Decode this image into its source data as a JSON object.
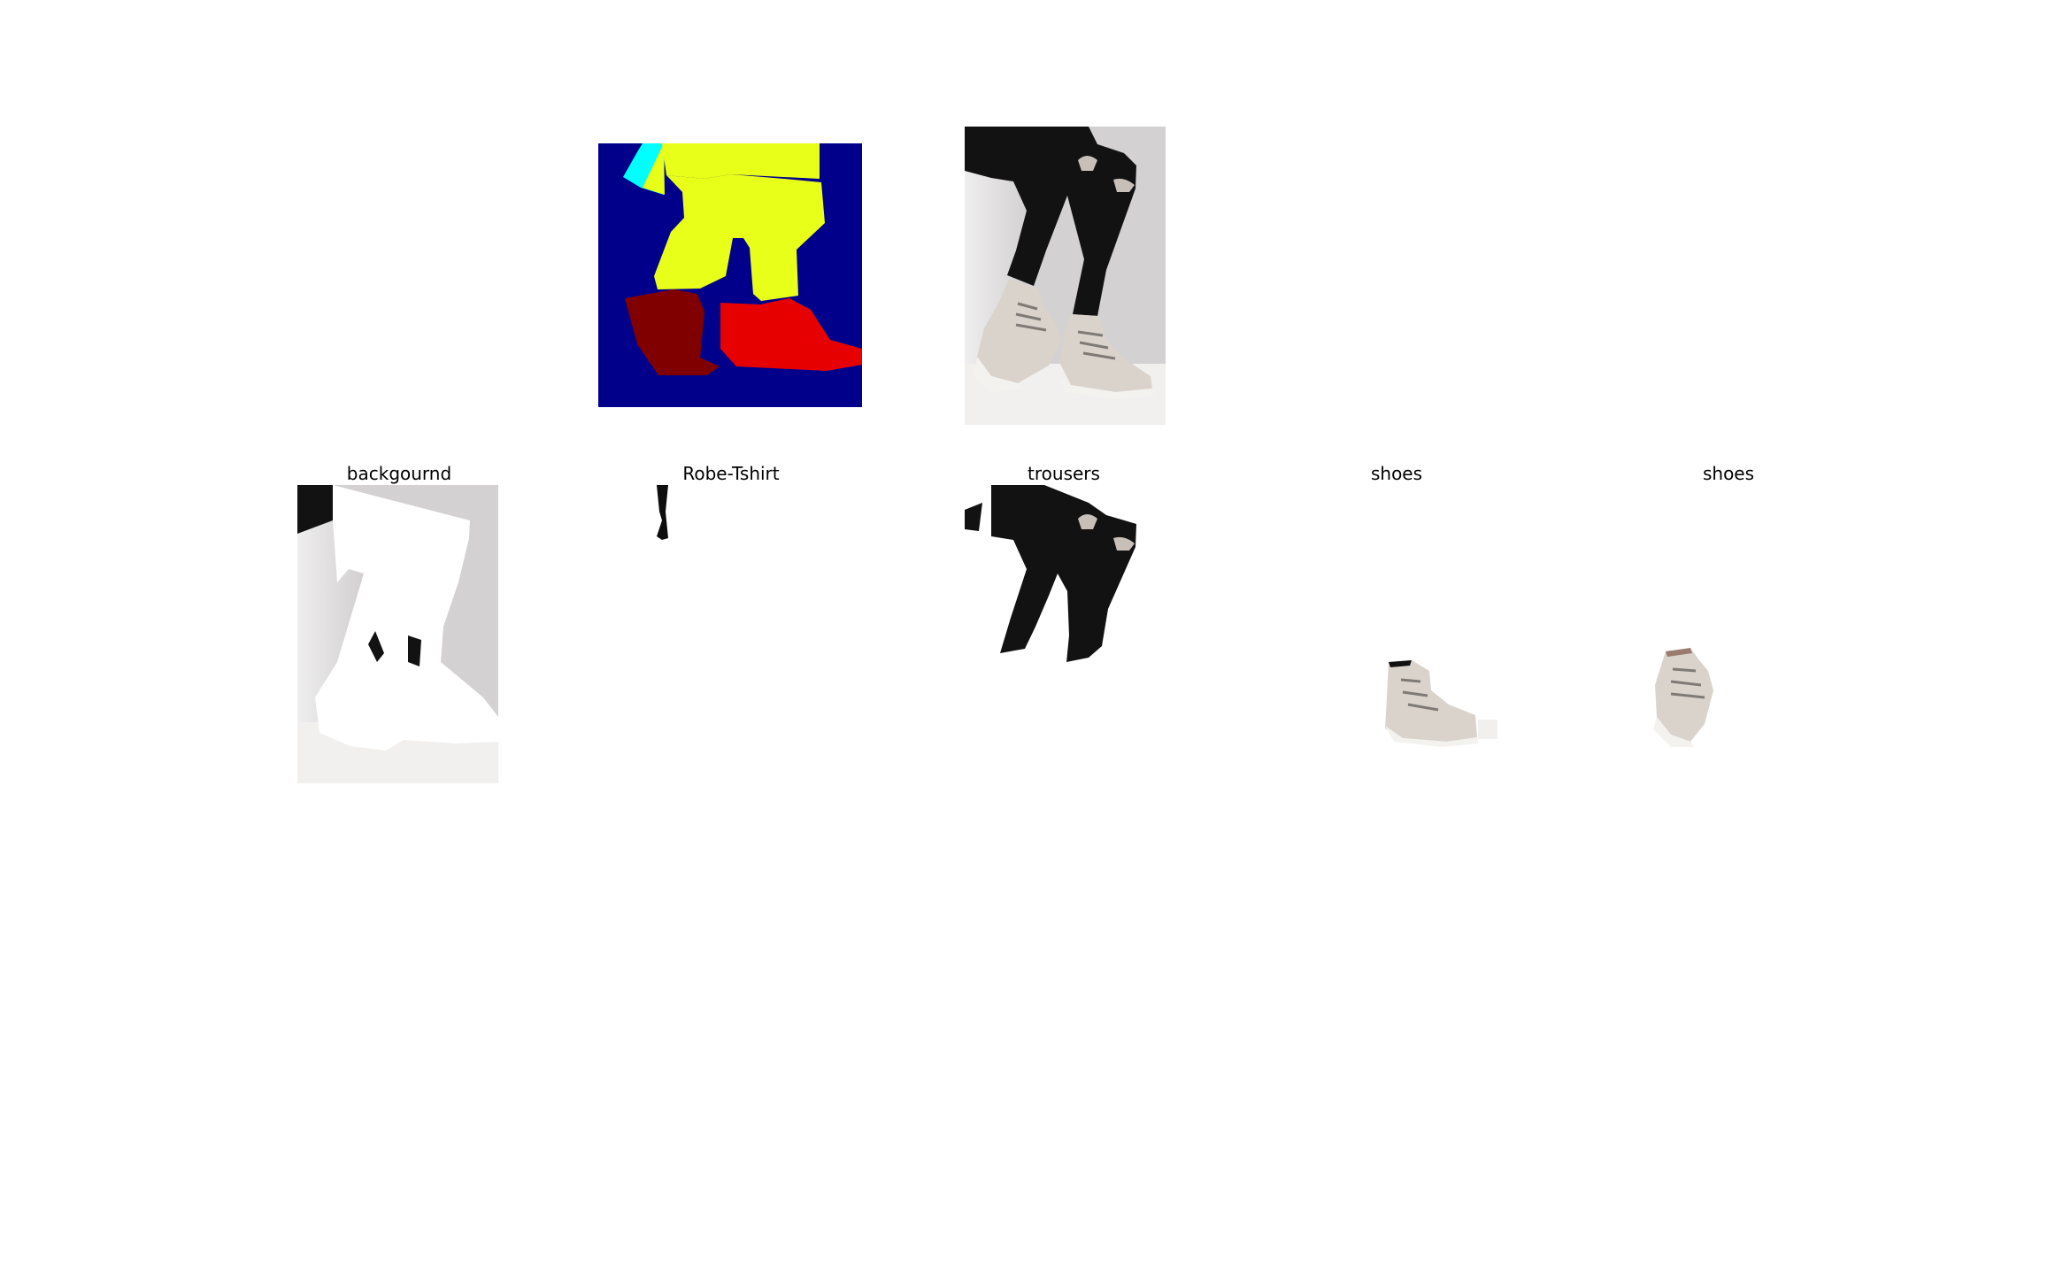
{
  "palette": {
    "mask_background": "#00008b",
    "mask_robe_tshirt": "#00ffff",
    "mask_trousers": "#e8ff1a",
    "mask_shoe_left": "#800000",
    "mask_shoe_right": "#e60000",
    "photo_backdrop": "#d3d1d1",
    "photo_floor": "#f1f0ef",
    "photo_trousers": "#121212",
    "photo_boots": "#d9d3cc"
  },
  "top_row": {
    "segmentation_mask": {
      "icon": "segmentation-mask-image"
    },
    "original_photo": {
      "icon": "original-photo-image"
    }
  },
  "crops": [
    {
      "label": "backgournd",
      "icon": "background-crop-image"
    },
    {
      "label": "Robe-Tshirt",
      "icon": "robe-tshirt-crop-image"
    },
    {
      "label": "trousers",
      "icon": "trousers-crop-image"
    },
    {
      "label": "shoes",
      "icon": "shoe-crop-image"
    },
    {
      "label": "shoes",
      "icon": "shoe-crop-image"
    }
  ]
}
